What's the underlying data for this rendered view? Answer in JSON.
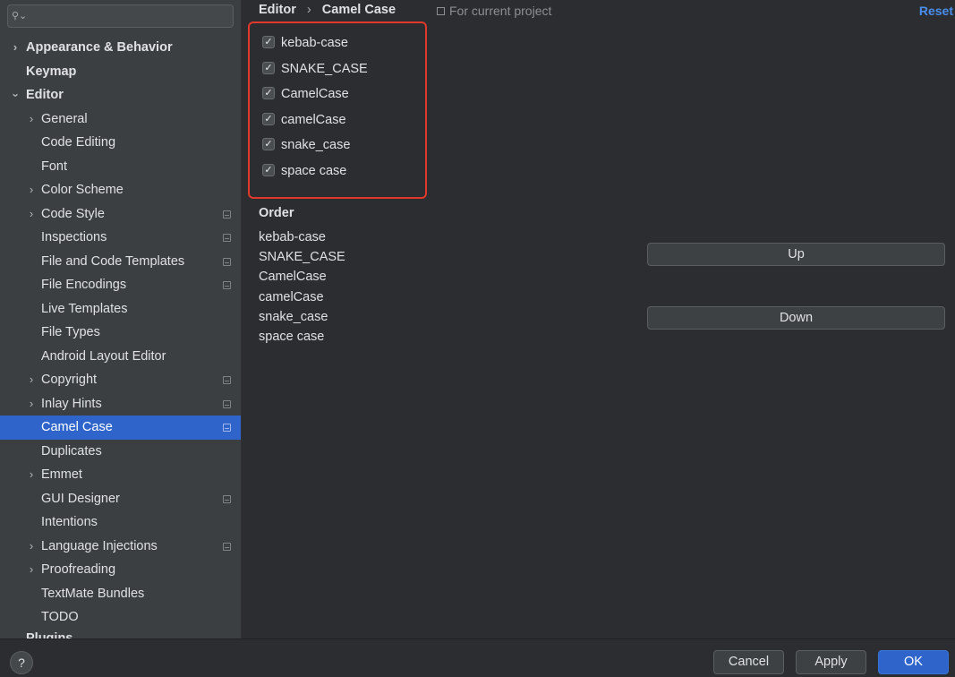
{
  "search": {
    "placeholder": ""
  },
  "sidebar": {
    "items": [
      {
        "label": "Appearance & Behavior",
        "chevron": "right",
        "bold": true,
        "indent": 0
      },
      {
        "label": "Keymap",
        "chevron": "none",
        "bold": true,
        "indent": 0
      },
      {
        "label": "Editor",
        "chevron": "down",
        "bold": true,
        "indent": 0
      },
      {
        "label": "General",
        "chevron": "right",
        "bold": false,
        "indent": 1
      },
      {
        "label": "Code Editing",
        "chevron": "none",
        "bold": false,
        "indent": 1
      },
      {
        "label": "Font",
        "chevron": "none",
        "bold": false,
        "indent": 1
      },
      {
        "label": "Color Scheme",
        "chevron": "right",
        "bold": false,
        "indent": 1
      },
      {
        "label": "Code Style",
        "chevron": "right",
        "bold": false,
        "indent": 1,
        "project": true
      },
      {
        "label": "Inspections",
        "chevron": "none",
        "bold": false,
        "indent": 1,
        "project": true
      },
      {
        "label": "File and Code Templates",
        "chevron": "none",
        "bold": false,
        "indent": 1,
        "project": true
      },
      {
        "label": "File Encodings",
        "chevron": "none",
        "bold": false,
        "indent": 1,
        "project": true
      },
      {
        "label": "Live Templates",
        "chevron": "none",
        "bold": false,
        "indent": 1
      },
      {
        "label": "File Types",
        "chevron": "none",
        "bold": false,
        "indent": 1
      },
      {
        "label": "Android Layout Editor",
        "chevron": "none",
        "bold": false,
        "indent": 1
      },
      {
        "label": "Copyright",
        "chevron": "right",
        "bold": false,
        "indent": 1,
        "project": true
      },
      {
        "label": "Inlay Hints",
        "chevron": "right",
        "bold": false,
        "indent": 1,
        "project": true
      },
      {
        "label": "Camel Case",
        "chevron": "none",
        "bold": false,
        "indent": 1,
        "project": true,
        "selected": true
      },
      {
        "label": "Duplicates",
        "chevron": "none",
        "bold": false,
        "indent": 1
      },
      {
        "label": "Emmet",
        "chevron": "right",
        "bold": false,
        "indent": 1
      },
      {
        "label": "GUI Designer",
        "chevron": "none",
        "bold": false,
        "indent": 1,
        "project": true
      },
      {
        "label": "Intentions",
        "chevron": "none",
        "bold": false,
        "indent": 1
      },
      {
        "label": "Language Injections",
        "chevron": "right",
        "bold": false,
        "indent": 1,
        "project": true
      },
      {
        "label": "Proofreading",
        "chevron": "right",
        "bold": false,
        "indent": 1
      },
      {
        "label": "TextMate Bundles",
        "chevron": "none",
        "bold": false,
        "indent": 1
      },
      {
        "label": "TODO",
        "chevron": "none",
        "bold": false,
        "indent": 1
      }
    ],
    "partial_item": "Plugins"
  },
  "header": {
    "breadcrumb_parent": "Editor",
    "breadcrumb_separator": "›",
    "breadcrumb_current": "Camel Case",
    "project_note": "For current project",
    "reset_label": "Reset"
  },
  "checkboxes": [
    {
      "label": "kebab-case",
      "checked": true
    },
    {
      "label": "SNAKE_CASE",
      "checked": true
    },
    {
      "label": "CamelCase",
      "checked": true
    },
    {
      "label": "camelCase",
      "checked": true
    },
    {
      "label": "snake_case",
      "checked": true
    },
    {
      "label": "space case",
      "checked": true
    }
  ],
  "order": {
    "heading": "Order",
    "items": [
      "kebab-case",
      "SNAKE_CASE",
      "CamelCase",
      "camelCase",
      "snake_case",
      "space case"
    ],
    "up_label": "Up",
    "down_label": "Down"
  },
  "footer": {
    "help_label": "?",
    "cancel_label": "Cancel",
    "apply_label": "Apply",
    "ok_label": "OK"
  },
  "colors": {
    "accent": "#2f65ca",
    "highlight_border": "#e0392b",
    "link": "#4a8eed"
  },
  "icons": {
    "search": "search-icon",
    "check": "checkmark-icon",
    "expand": "chevron-right-icon",
    "collapse": "chevron-down-icon",
    "project_scope": "project-scope-icon"
  }
}
